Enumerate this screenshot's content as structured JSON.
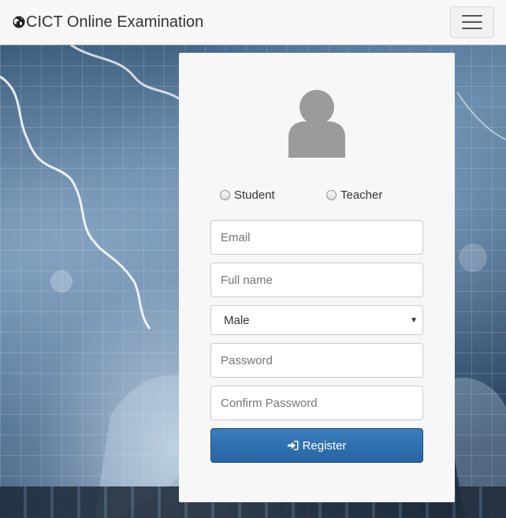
{
  "navbar": {
    "brand_text": "CICT Online Examination",
    "brand_icon": "globe-icon",
    "menu_icon": "hamburger-icon"
  },
  "form": {
    "avatar_icon": "user-avatar-icon",
    "roles": [
      {
        "label": "Student",
        "selected": false
      },
      {
        "label": "Teacher",
        "selected": false
      }
    ],
    "email_placeholder": "Email",
    "fullname_placeholder": "Full name",
    "gender_selected": "Male",
    "password_placeholder": "Password",
    "confirm_password_placeholder": "Confirm Password",
    "register_label": "Register",
    "register_icon": "sign-in-icon"
  },
  "colors": {
    "primary_button": "#2d6eae",
    "navbar_bg": "#f8f8f8",
    "card_bg": "#f7f7f7"
  }
}
